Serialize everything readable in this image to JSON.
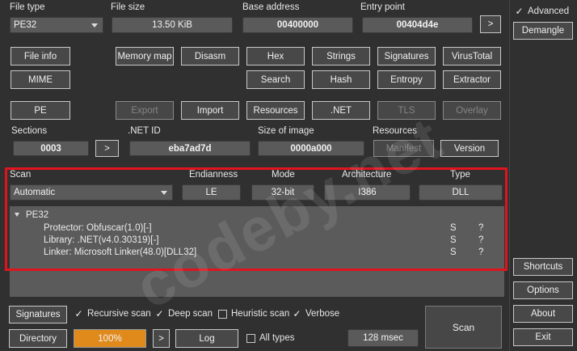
{
  "header": {
    "file_type_label": "File type",
    "file_type_value": "PE32",
    "file_size_label": "File size",
    "file_size_value": "13.50 KiB",
    "base_address_label": "Base address",
    "base_address_value": "00400000",
    "entry_point_label": "Entry point",
    "entry_point_value": "00404d4e",
    "entry_point_go": ">"
  },
  "right_panel": {
    "advanced_label": "Advanced",
    "advanced_checked": true,
    "demangle": "Demangle",
    "shortcuts": "Shortcuts",
    "options": "Options",
    "about": "About",
    "exit": "Exit"
  },
  "tools_row1": [
    "File info",
    "Memory map",
    "Disasm",
    "Hex",
    "Strings",
    "Signatures",
    "VirusTotal"
  ],
  "tools_row2": [
    "MIME",
    "Search",
    "Hash",
    "Entropy",
    "Extractor"
  ],
  "pe_row": {
    "pe": "PE",
    "export": "Export",
    "import": "Import",
    "resources": "Resources",
    "dotnet": ".NET",
    "tls": "TLS",
    "overlay": "Overlay"
  },
  "info_row": {
    "sections_label": "Sections",
    "sections_value": "0003",
    "sections_go": ">",
    "netid_label": ".NET ID",
    "netid_value": "eba7ad7d",
    "image_size_label": "Size of image",
    "image_size_value": "0000a000",
    "resources_label": "Resources",
    "manifest": "Manifest",
    "version": "Version"
  },
  "scan_options": {
    "scan_label": "Scan",
    "scan_value": "Automatic",
    "endianness_label": "Endianness",
    "endianness_value": "LE",
    "mode_label": "Mode",
    "mode_value": "32-bit",
    "architecture_label": "Architecture",
    "architecture_value": "I386",
    "type_label": "Type",
    "type_value": "DLL"
  },
  "results": {
    "root": "PE32",
    "items": [
      {
        "text": "Protector: Obfuscar(1.0)[-]",
        "s": "S",
        "q": "?"
      },
      {
        "text": "Library: .NET(v4.0.30319)[-]",
        "s": "S",
        "q": "?"
      },
      {
        "text": "Linker: Microsoft Linker(48.0)[DLL32]",
        "s": "S",
        "q": "?"
      }
    ]
  },
  "bottom": {
    "signatures": "Signatures",
    "recursive_scan": "Recursive scan",
    "deep_scan": "Deep scan",
    "heuristic_scan": "Heuristic scan",
    "verbose": "Verbose",
    "directory": "Directory",
    "progress": "100%",
    "progress_fraction": 1.0,
    "go": ">",
    "log": "Log",
    "all_types": "All types",
    "elapsed": "128 msec",
    "scan": "Scan"
  },
  "watermark": "codeby.net",
  "colors": {
    "background": "#303030",
    "highlight_box": "#e0141e",
    "progress_fill": "#e08a1c"
  }
}
